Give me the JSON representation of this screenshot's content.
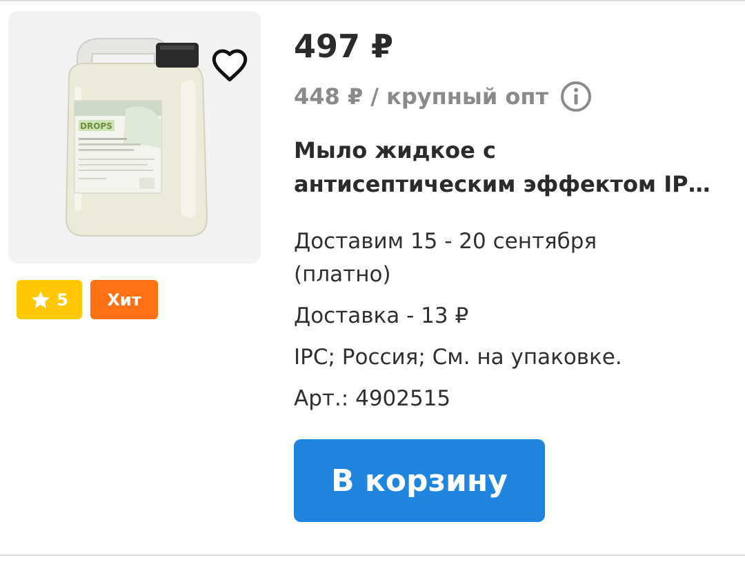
{
  "product": {
    "image_alt": "Мыло жидкое с антисептическим эффектом IPC",
    "label_brand": "DROPS",
    "price": "497 ₽",
    "wholesale_price": "448 ₽ / крупный опт",
    "title": "Мыло жидкое с антисептическим эффектом IP…",
    "delivery_dates": "Доставим 15 - 20 сентября",
    "delivery_paid": "(платно)",
    "delivery_cost": "Доставка - 13 ₽",
    "origin": "IPC; Россия; См. на упаковке.",
    "sku": "Арт.: 4902515"
  },
  "badges": {
    "rating": "5",
    "hit": "Хит"
  },
  "actions": {
    "add_to_cart": "В корзину"
  },
  "icons": {
    "favorite": "heart-outline-icon",
    "info": "info-circle-icon",
    "rating": "star-icon"
  },
  "colors": {
    "rating_badge": "#ffc800",
    "hit_badge": "#ff7112",
    "primary_button": "#1f85de",
    "muted_text": "#8a8a8a"
  }
}
